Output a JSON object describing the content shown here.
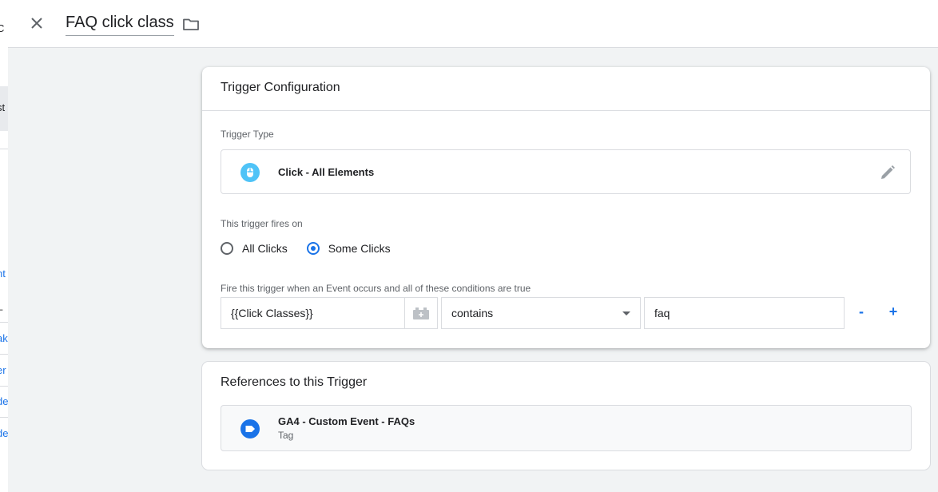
{
  "background_fragments": [
    "C",
    "st",
    "-",
    "nt",
    "_",
    "ak",
    "er",
    "de",
    "de"
  ],
  "header": {
    "title": "FAQ click class"
  },
  "trigger_config": {
    "heading": "Trigger Configuration",
    "trigger_type_label": "Trigger Type",
    "trigger_type": "Click - All Elements",
    "fires_on_label": "This trigger fires on",
    "options": [
      "All Clicks",
      "Some Clicks"
    ],
    "selected_option": "Some Clicks",
    "conditions_label": "Fire this trigger when an Event occurs and all of these conditions are true",
    "condition": {
      "variable": "{{Click Classes}}",
      "operator": "contains",
      "value": "faq"
    },
    "remove_label": "-",
    "add_label": "+"
  },
  "references": {
    "heading": "References to this Trigger",
    "items": [
      {
        "name": "GA4 - Custom Event - FAQs",
        "kind": "Tag"
      }
    ]
  },
  "colors": {
    "accent": "#1a73e8",
    "click_icon": "#4fc3f7",
    "tag_icon": "#1a73e8"
  }
}
